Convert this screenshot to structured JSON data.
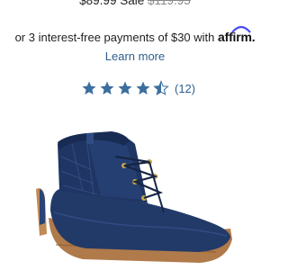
{
  "price": {
    "sale_price": "$89.99",
    "sale_label": "Sale",
    "original_price": "$119.95"
  },
  "installments": {
    "text": "or 3 interest-free payments of $30 with",
    "provider_logo": "affirm.",
    "learn_more": "Learn more"
  },
  "rating": {
    "value": 4.5,
    "max": 5,
    "review_count": "(12)",
    "star_color": "#3c6e9e"
  },
  "product_image": {
    "icon": "navy-duck-boot-image",
    "colors": {
      "upper": "#223a68",
      "sole": "#b07a4a"
    }
  }
}
